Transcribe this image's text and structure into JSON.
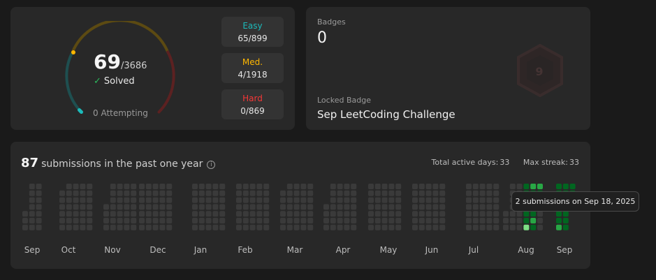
{
  "progress": {
    "solved": "69",
    "total": "/3686",
    "solved_label": "Solved",
    "attempting": "0 Attempting",
    "easy": {
      "label": "Easy",
      "count": "65/899"
    },
    "medium": {
      "label": "Med.",
      "count": "4/1918"
    },
    "hard": {
      "label": "Hard",
      "count": "0/869"
    },
    "colors": {
      "easy": "#1cbaba",
      "medium": "#ffb700",
      "hard": "#f63737"
    }
  },
  "badges": {
    "title": "Badges",
    "count": "0",
    "locked_title": "Locked Badge",
    "locked_name": "Sep LeetCoding Challenge"
  },
  "calendar": {
    "submissions": "87",
    "submissions_label": "submissions in the past one year",
    "info_icon": "info-icon",
    "total_active_label": "Total active days:",
    "total_active_value": "33",
    "max_streak_label": "Max streak:",
    "max_streak_value": "33",
    "months": [
      "Sep",
      "Oct",
      "Nov",
      "Dec",
      "Jan",
      "Feb",
      "Mar",
      "Apr",
      "May",
      "Jun",
      "Jul",
      "Aug",
      "Sep"
    ],
    "tooltip": "2 submissions on Sep 18, 2025",
    "colors": {
      "empty": "#3a3a3a",
      "low": "#016620",
      "mid": "#28a745",
      "high": "#7ee085"
    }
  }
}
